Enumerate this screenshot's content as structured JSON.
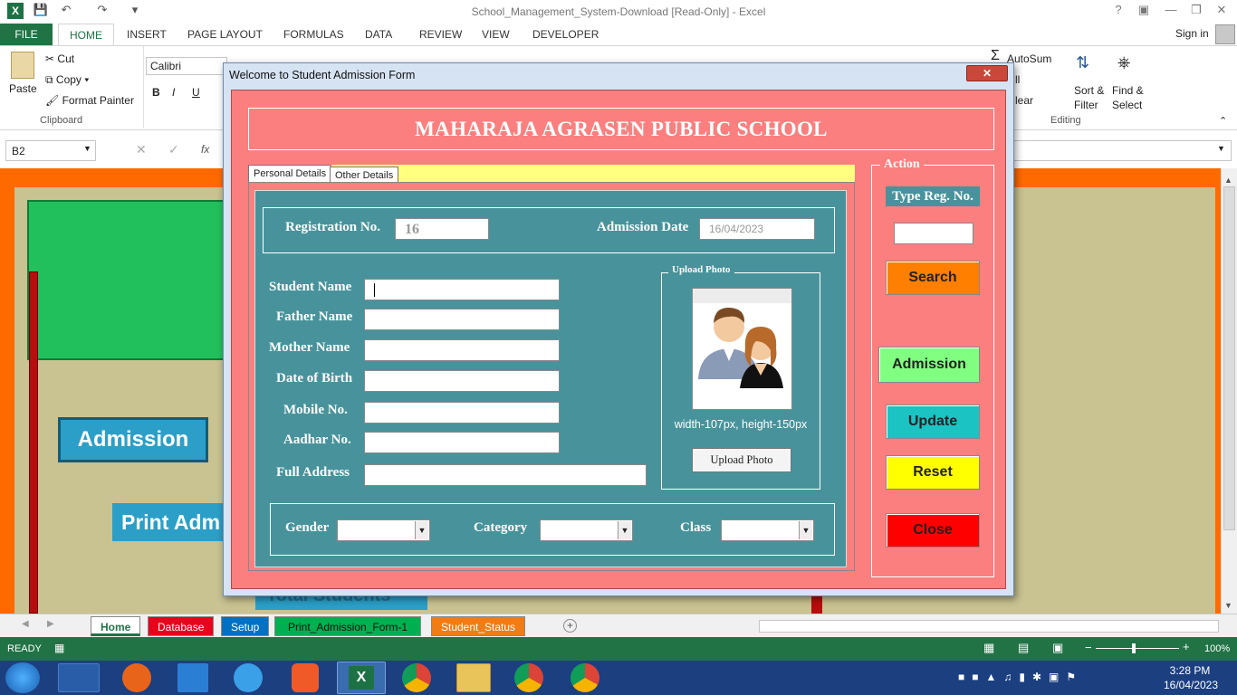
{
  "window": {
    "title": "School_Management_System-Download  [Read-Only] - Excel",
    "help_icon": "?",
    "signin": "Sign in"
  },
  "ribbon": {
    "tabs": [
      "FILE",
      "HOME",
      "INSERT",
      "PAGE LAYOUT",
      "FORMULAS",
      "DATA",
      "REVIEW",
      "VIEW",
      "DEVELOPER"
    ],
    "clipboard": {
      "paste": "Paste",
      "cut": "Cut",
      "copy": "Copy",
      "format_painter": "Format Painter",
      "group": "Clipboard"
    },
    "font": {
      "name": "Calibri",
      "bold": "B",
      "italic": "I",
      "underline": "U"
    },
    "editing": {
      "autosum": "AutoSum",
      "fill": "ll",
      "clear": "lear",
      "sort": "Sort &",
      "filter": "Filter",
      "find": "Find &",
      "select": "Select",
      "group": "Editing"
    }
  },
  "formula_bar": {
    "name_box": "B2",
    "fx": "fx"
  },
  "sheet": {
    "buttons": {
      "admission": "Admission",
      "print_adm": "Print Adm",
      "total_students": "Total Students"
    }
  },
  "sheet_tabs": [
    {
      "label": "Home",
      "color": "#ffffff",
      "text": "#217346"
    },
    {
      "label": "Database",
      "color": "#e8001c",
      "text": "#ffffff"
    },
    {
      "label": "Setup",
      "color": "#0070c0",
      "text": "#ffffff"
    },
    {
      "label": "Print_Admission_Form-1",
      "color": "#00b050",
      "text": "#111111"
    },
    {
      "label": "Student_Status",
      "color": "#f07c17",
      "text": "#ffffff"
    }
  ],
  "status": {
    "ready": "READY",
    "zoom": "100%"
  },
  "taskbar": {
    "time": "3:28 PM",
    "date": "16/04/2023"
  },
  "dialog": {
    "title": "Welcome to Student Admission Form",
    "close": "✕",
    "school_name": "MAHARAJA AGRASEN PUBLIC SCHOOL",
    "tabs": [
      "Personal Details",
      "Other Details"
    ],
    "registration_label": "Registration No.",
    "registration_value": "16",
    "admission_date_label": "Admission Date",
    "admission_date_value": "16/04/2023",
    "fields": {
      "student_name": "Student Name",
      "father_name": "Father Name",
      "mother_name": "Mother Name",
      "dob": "Date of Birth",
      "mobile": "Mobile No.",
      "aadhar": "Aadhar No.",
      "address": "Full Address"
    },
    "photo": {
      "frame_label": "Upload Photo",
      "size_hint": "width-107px, height-150px",
      "button": "Upload Photo"
    },
    "dropdowns": {
      "gender": "Gender",
      "category": "Category",
      "class": "Class"
    },
    "action": {
      "frame_label": "Action",
      "type_reg": "Type Reg. No.",
      "search": "Search",
      "admission": "Admission",
      "update": "Update",
      "reset": "Reset",
      "close": "Close"
    },
    "colors": {
      "form_bg": "#fb7f7f",
      "panel_bg": "#48939b",
      "search": "#ff7f00",
      "admission": "#80ff80",
      "update": "#1cc3c3",
      "reset": "#ffff00",
      "close": "#ff0000"
    }
  }
}
